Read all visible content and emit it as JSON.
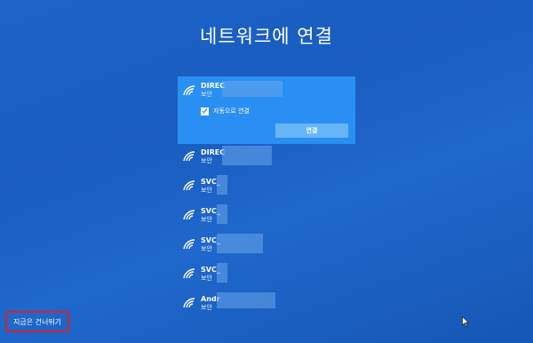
{
  "page": {
    "title": "네트워크에 연결"
  },
  "networks": [
    {
      "name": "DIREC",
      "status": "보안",
      "selected": true
    },
    {
      "name": "DIREC",
      "status": "보안"
    },
    {
      "name": "SVC_",
      "status": "보안"
    },
    {
      "name": "SVC_",
      "status": "보안"
    },
    {
      "name": "SVC_",
      "status": "보안"
    },
    {
      "name": "SVC_",
      "status": "보안"
    },
    {
      "name": "Andr",
      "status": "보안"
    }
  ],
  "selected_network": {
    "auto_connect_label": "자동으로 연결",
    "auto_connect_checked": true,
    "connect_label": "연결"
  },
  "footer": {
    "skip_label": "지금은 건너뛰기"
  },
  "colors": {
    "background": "#1c64c8",
    "selected": "#2a8ff2",
    "button": "#66b5f7",
    "highlight_box": "#d8222a"
  },
  "icons": {
    "network": "wifi-icon",
    "check": "check-icon",
    "cursor": "mouse-cursor-icon"
  }
}
